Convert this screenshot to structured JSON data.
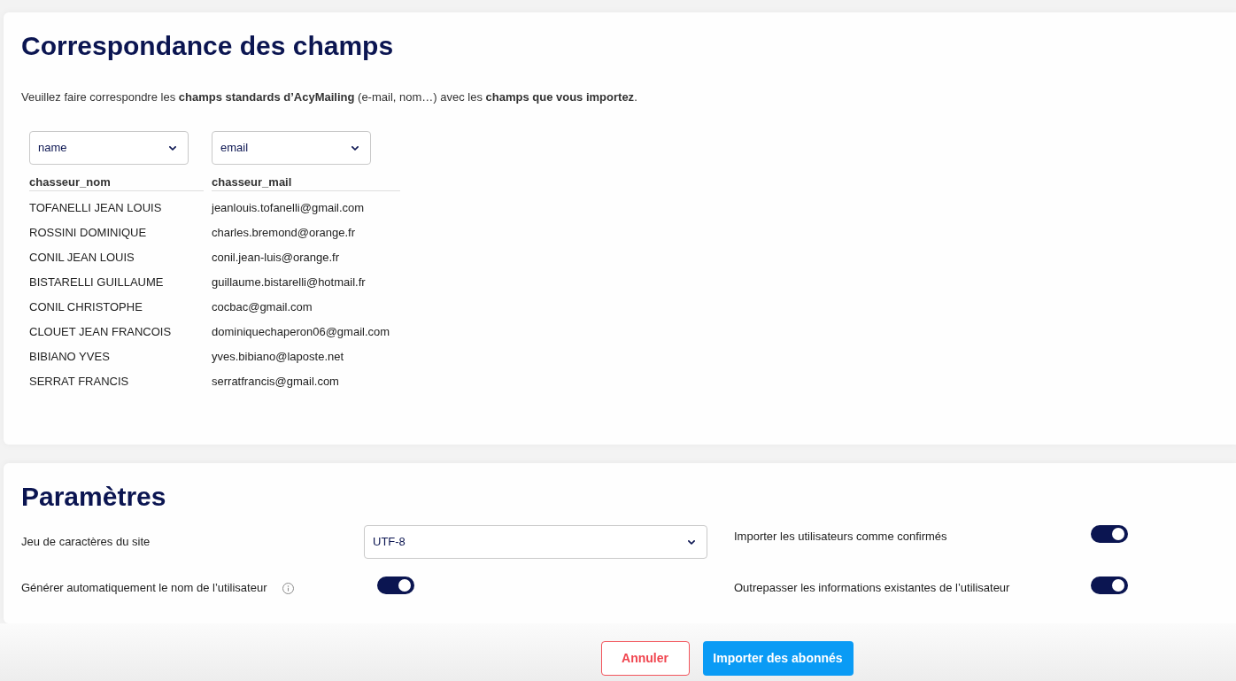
{
  "mapping": {
    "title": "Correspondance des champs",
    "intro": "Veuillez faire correspondre les **champs standards d’AcyMailing** (e-mail, nom…) avec les **champs que vous importez**.",
    "columns": [
      {
        "field": "name",
        "header": "chasseur_nom"
      },
      {
        "field": "email",
        "header": "chasseur_mail"
      }
    ],
    "rows": [
      [
        "TOFANELLI JEAN LOUIS",
        "jeanlouis.tofanelli@gmail.com"
      ],
      [
        "ROSSINI DOMINIQUE",
        "charles.bremond@orange.fr"
      ],
      [
        "CONIL JEAN LOUIS",
        "conil.jean-luis@orange.fr"
      ],
      [
        "BISTARELLI GUILLAUME",
        "guillaume.bistarelli@hotmail.fr"
      ],
      [
        "CONIL CHRISTOPHE",
        "cocbac@gmail.com"
      ],
      [
        "CLOUET JEAN FRANCOIS",
        "dominiquechaperon06@gmail.com"
      ],
      [
        "BIBIANO YVES",
        "yves.bibiano@laposte.net"
      ],
      [
        "SERRAT FRANCIS",
        "serratfrancis@gmail.com"
      ]
    ]
  },
  "settings": {
    "title": "Paramètres",
    "rows": [
      [
        {
          "kind": "select",
          "label": "Jeu de caractères du site",
          "value": "UTF-8"
        },
        {
          "kind": "toggle",
          "label": "Importer les utilisateurs comme confirmés",
          "on": true
        }
      ],
      [
        {
          "kind": "toggle",
          "label": "Générer automatiquement le nom de l’utilisateur",
          "info": true,
          "on": true
        },
        {
          "kind": "toggle",
          "label": "Outrepasser les informations existantes de l’utilisateur",
          "on": true
        }
      ]
    ]
  },
  "buttons": [
    {
      "kind": "cancel",
      "label": "Annuler"
    },
    {
      "kind": "primary",
      "label": "Importer des abonnés"
    }
  ]
}
